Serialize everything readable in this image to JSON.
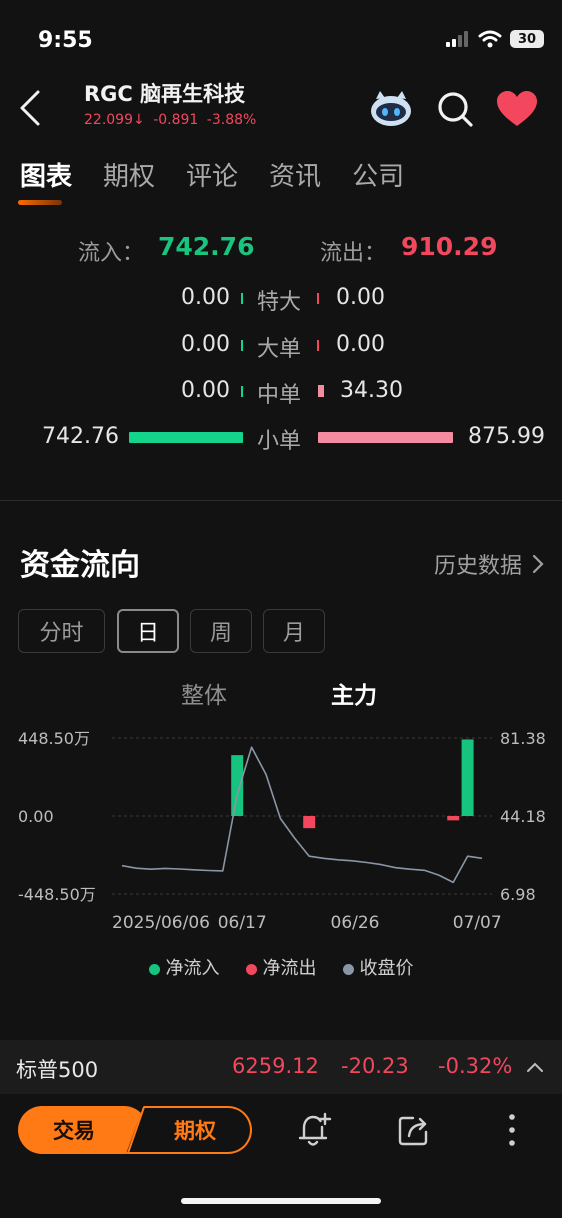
{
  "status": {
    "time": "9:55",
    "battery": "30"
  },
  "header": {
    "ticker": "RGC 脑再生科技",
    "price": "22.099",
    "change": "-0.891",
    "change_pct": "-3.88%",
    "price_arrow": "arrow-down-icon"
  },
  "tabs": [
    {
      "label": "图表",
      "active": true
    },
    {
      "label": "期权"
    },
    {
      "label": "评论"
    },
    {
      "label": "资讯"
    },
    {
      "label": "公司"
    }
  ],
  "flow": {
    "inflow_label": "流入：",
    "inflow_value": "742.76",
    "outflow_label": "流出：",
    "outflow_value": "910.29",
    "rows": [
      {
        "label": "特大",
        "in": "0.00",
        "out": "0.00"
      },
      {
        "label": "大单",
        "in": "0.00",
        "out": "0.00"
      },
      {
        "label": "中单",
        "in": "0.00",
        "out": "34.30"
      },
      {
        "label": "小单",
        "in": "742.76",
        "out": "875.99"
      }
    ]
  },
  "section": {
    "title": "资金流向",
    "history_label": "历史数据"
  },
  "periods": [
    {
      "label": "分时"
    },
    {
      "label": "日",
      "active": true
    },
    {
      "label": "周"
    },
    {
      "label": "月"
    }
  ],
  "subtabs": [
    {
      "label": "整体"
    },
    {
      "label": "主力",
      "active": true
    }
  ],
  "chart_data": {
    "type": "bar",
    "left_axis": {
      "ticks": [
        "448.50万",
        "0.00",
        "-448.50万"
      ],
      "range": [
        -448.5,
        448.5
      ],
      "unit": "万"
    },
    "right_axis": {
      "ticks": [
        "81.38",
        "44.18",
        "6.98"
      ],
      "range": [
        6.98,
        81.38
      ]
    },
    "x_tick_labels": [
      "2025/06/06",
      "06/17",
      "06/26",
      "07/07"
    ],
    "bars": [
      {
        "index": 8,
        "value": 350,
        "series": "净流入"
      },
      {
        "index": 13,
        "value": -70,
        "series": "净流出"
      },
      {
        "index": 23,
        "value": -25,
        "series": "净流出"
      },
      {
        "index": 24,
        "value": 440,
        "series": "净流入"
      }
    ],
    "close_price": {
      "series": "收盘价",
      "values": [
        20.5,
        19.3,
        18.8,
        19.2,
        18.9,
        18.5,
        18.2,
        18.0,
        54.5,
        77.0,
        64.0,
        43.0,
        33.5,
        25.0,
        24.0,
        23.3,
        22.8,
        22.0,
        21.0,
        19.5,
        18.8,
        18.3,
        16.0,
        12.5,
        25.0,
        24.0
      ]
    },
    "legend": [
      "净流入",
      "净流出",
      "收盘价"
    ],
    "colors": {
      "inflow": "#16c47f",
      "outflow": "#f2475d",
      "price": "#8a96a6"
    }
  },
  "index_ticker": {
    "name": "标普500",
    "value": "6259.12",
    "change": "-20.23",
    "change_pct": "-0.32%"
  },
  "toolbar": {
    "trade_label": "交易",
    "options_label": "期权",
    "icons": [
      "bell-plus-icon",
      "share-icon",
      "more-vertical-icon"
    ]
  }
}
